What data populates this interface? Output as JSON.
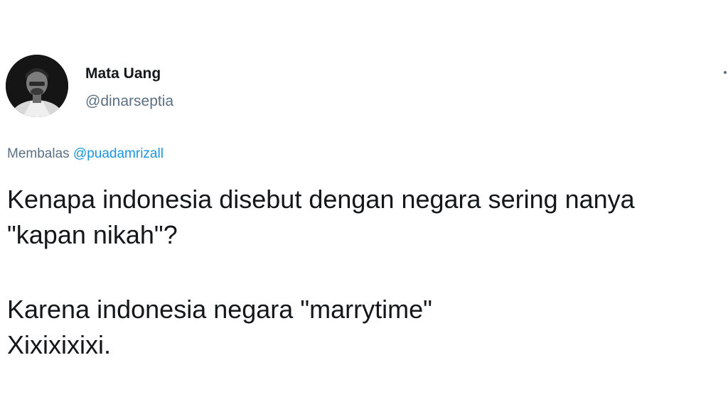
{
  "tweet": {
    "author": {
      "name": "Mata Uang",
      "handle": "@dinarseptia"
    },
    "reply": {
      "prefix": "Membalas",
      "mention": "@puadamrizall"
    },
    "body": {
      "line1": "Kenapa indonesia disebut dengan negara sering nanya",
      "line2": "\"kapan nikah\"?",
      "line3": "Karena indonesia negara \"marrytime\"",
      "line4": "Xixixixixi."
    },
    "more_icon": "more-dots-icon",
    "colors": {
      "mention": "#1b95e0",
      "secondary_text": "#5b7083",
      "primary_text": "#14171a"
    }
  }
}
